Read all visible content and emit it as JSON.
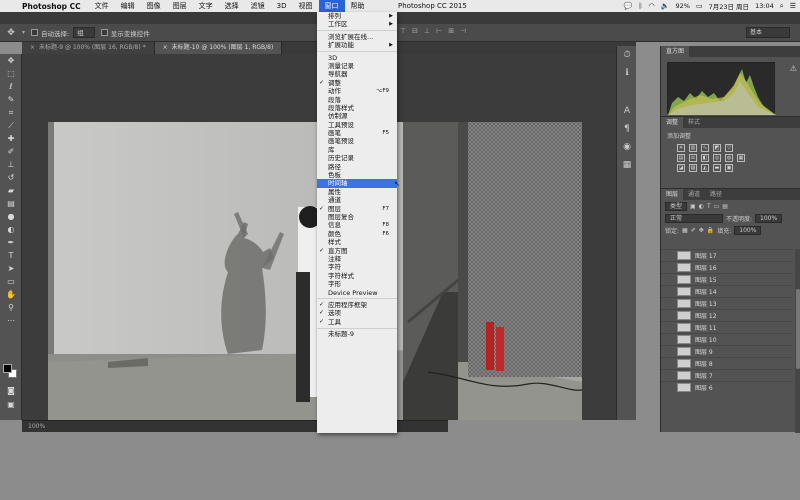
{
  "menubar": {
    "app_name": "Photoshop CC",
    "items": [
      "文件",
      "编辑",
      "图像",
      "图层",
      "文字",
      "选择",
      "滤镜",
      "3D",
      "视图",
      "窗口",
      "帮助"
    ],
    "active_item": "窗口",
    "window_title": "Photoshop CC 2015",
    "status": {
      "battery": "92%",
      "date": "7月23日 周日",
      "time": "13:04"
    }
  },
  "optbar": {
    "auto_select_label": "自动选择:",
    "auto_select_value": "组",
    "show_transform_label": "显示变换控件",
    "workspace": "基本"
  },
  "doc_tabs": [
    {
      "label": "未标题-9 @ 100% (图层 16, RGB/8) *",
      "active": false
    },
    {
      "label": "未标题-10 @ 100% (图层 1, RGB/8)",
      "active": true
    }
  ],
  "canvas_status": "100%",
  "panels": {
    "histogram_tab": "直方图",
    "adjust_tabs": [
      "调整",
      "样式"
    ],
    "adjust_title": "添加调整",
    "layers_tabs": [
      "图层",
      "通道",
      "路径"
    ],
    "kind_label": "类型",
    "blend_mode": "正常",
    "opacity_label": "不透明度:",
    "opacity_value": "100%",
    "lock_label": "锁定:",
    "fill_label": "填充:",
    "fill_value": "100%",
    "layers": [
      "图层 17",
      "图层 16",
      "图层 15",
      "图层 14",
      "图层 13",
      "图层 12",
      "图层 11",
      "图层 10",
      "图层 9",
      "图层 8",
      "图层 7",
      "图层 6"
    ]
  },
  "window_menu": {
    "items": [
      {
        "label": "排列",
        "arrow": true
      },
      {
        "label": "工作区",
        "arrow": true
      },
      {
        "sep": true
      },
      {
        "label": "浏览扩展在线..."
      },
      {
        "label": "扩展功能",
        "arrow": true
      },
      {
        "sep": true
      },
      {
        "label": "3D"
      },
      {
        "label": "测量记录"
      },
      {
        "label": "导航器"
      },
      {
        "label": "调整",
        "check": true
      },
      {
        "label": "动作",
        "shortcut": "⌥F9"
      },
      {
        "label": "段落"
      },
      {
        "label": "段落样式"
      },
      {
        "label": "仿制源"
      },
      {
        "label": "工具预设"
      },
      {
        "label": "画笔",
        "shortcut": "F5"
      },
      {
        "label": "画笔预设"
      },
      {
        "label": "库"
      },
      {
        "label": "历史记录"
      },
      {
        "label": "路径"
      },
      {
        "label": "色板"
      },
      {
        "label": "时间轴",
        "highlight": true
      },
      {
        "label": "属性"
      },
      {
        "label": "通道"
      },
      {
        "label": "图层",
        "check": true,
        "shortcut": "F7"
      },
      {
        "label": "图层复合"
      },
      {
        "label": "信息",
        "shortcut": "F8"
      },
      {
        "label": "颜色",
        "shortcut": "F6"
      },
      {
        "label": "样式"
      },
      {
        "label": "直方图",
        "check": true
      },
      {
        "label": "注释"
      },
      {
        "label": "字符"
      },
      {
        "label": "字符样式"
      },
      {
        "label": "字形"
      },
      {
        "label": "Device Preview"
      },
      {
        "sep": true
      },
      {
        "label": "应用程序框架",
        "check": true
      },
      {
        "label": "选项",
        "check": true
      },
      {
        "label": "工具",
        "check": true
      },
      {
        "sep": true
      },
      {
        "label": "未标题-9"
      }
    ]
  }
}
